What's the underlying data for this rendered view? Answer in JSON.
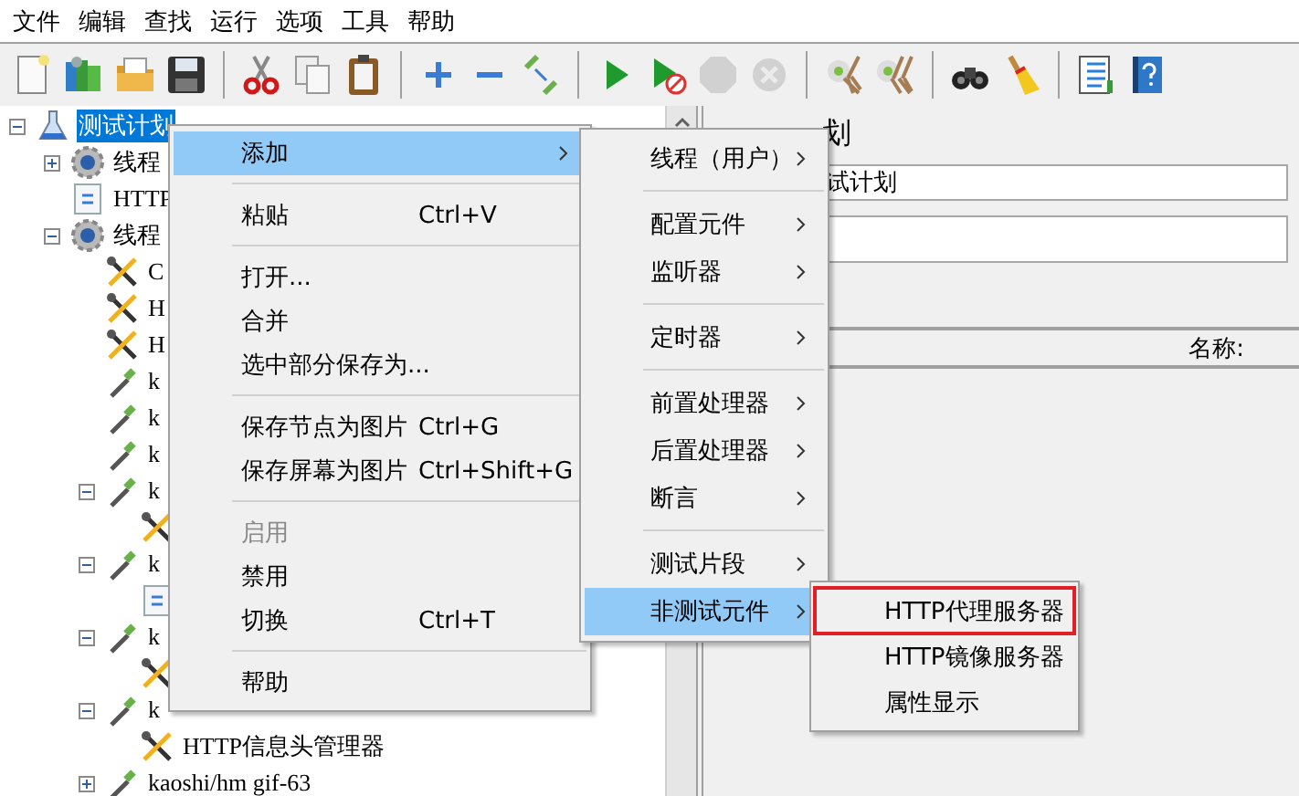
{
  "menu_bar": [
    "文件",
    "编辑",
    "查找",
    "运行",
    "选项",
    "工具",
    "帮助"
  ],
  "toolbar": [
    {
      "kind": "new",
      "disabled": false
    },
    {
      "kind": "templates",
      "disabled": false
    },
    {
      "kind": "open",
      "disabled": false
    },
    {
      "kind": "save",
      "disabled": false
    },
    {
      "kind": "separator"
    },
    {
      "kind": "cut",
      "disabled": false
    },
    {
      "kind": "copy",
      "disabled": false
    },
    {
      "kind": "paste",
      "disabled": false
    },
    {
      "kind": "separator"
    },
    {
      "kind": "expand",
      "disabled": false
    },
    {
      "kind": "collapse",
      "disabled": false
    },
    {
      "kind": "toggle",
      "disabled": false
    },
    {
      "kind": "separator"
    },
    {
      "kind": "start",
      "disabled": false
    },
    {
      "kind": "start_no_pause",
      "disabled": false
    },
    {
      "kind": "stop",
      "disabled": true
    },
    {
      "kind": "shutdown",
      "disabled": true
    },
    {
      "kind": "separator"
    },
    {
      "kind": "clear",
      "disabled": false
    },
    {
      "kind": "clear_all",
      "disabled": false
    },
    {
      "kind": "separator"
    },
    {
      "kind": "search",
      "disabled": false
    },
    {
      "kind": "reset_search",
      "disabled": false
    },
    {
      "kind": "separator"
    },
    {
      "kind": "functions",
      "disabled": false
    },
    {
      "kind": "help",
      "disabled": false
    }
  ],
  "tree": {
    "nodes": [
      {
        "kind": "plan",
        "label": "测试计划",
        "selected": true,
        "expanded": true,
        "children": [
          {
            "kind": "gear",
            "label": "线程",
            "selected": false,
            "expanded": false
          },
          {
            "kind": "doc",
            "label": "HTTP",
            "selected": false
          },
          {
            "kind": "gear",
            "label": "线程",
            "selected": false,
            "expanded": true,
            "children": [
              {
                "kind": "wrench",
                "label": "C",
                "selected": false
              },
              {
                "kind": "wrench",
                "label": "H",
                "selected": false
              },
              {
                "kind": "wrench",
                "label": "H",
                "selected": false
              },
              {
                "kind": "pipette",
                "label": "k",
                "selected": false
              },
              {
                "kind": "pipette",
                "label": "k",
                "selected": false
              },
              {
                "kind": "pipette",
                "label": "k",
                "selected": false
              },
              {
                "kind": "pipette",
                "label": "k",
                "selected": false,
                "expanded": true,
                "children": [
                  {
                    "kind": "wrench",
                    "selected": false
                  }
                ]
              },
              {
                "kind": "pipette",
                "label": "k",
                "selected": false,
                "expanded": true,
                "children": [
                  {
                    "kind": "doc",
                    "selected": false
                  }
                ]
              },
              {
                "kind": "pipette",
                "label": "k",
                "selected": false,
                "expanded": true,
                "children": [
                  {
                    "kind": "wrench",
                    "selected": false
                  }
                ]
              },
              {
                "kind": "pipette",
                "label": "k",
                "selected": false,
                "expanded": true,
                "children": [
                  {
                    "kind": "wrench",
                    "label": "HTTP信息头管理器",
                    "selected": false
                  }
                ]
              },
              {
                "kind": "pipette",
                "label": "kaoshi/hm gif-63",
                "selected": false,
                "expanded": false
              }
            ]
          }
        ]
      }
    ]
  },
  "test_plan_panel": {
    "title": "划",
    "name_value": "试计划",
    "column_header": "名称:"
  },
  "context_menu": {
    "items": [
      {
        "kind": "item",
        "label": "添加",
        "selected": true,
        "disabled": false,
        "has_submenu": true
      },
      {
        "kind": "separator"
      },
      {
        "kind": "item",
        "label": "粘贴",
        "shortcut": "Ctrl+V",
        "selected": false,
        "disabled": false,
        "has_submenu": false
      },
      {
        "kind": "separator"
      },
      {
        "kind": "item",
        "label": "打开...",
        "selected": false,
        "disabled": false,
        "has_submenu": false
      },
      {
        "kind": "item",
        "label": "合并",
        "selected": false,
        "disabled": false,
        "has_submenu": false
      },
      {
        "kind": "item",
        "label": "选中部分保存为...",
        "selected": false,
        "disabled": false,
        "has_submenu": false
      },
      {
        "kind": "separator"
      },
      {
        "kind": "item",
        "label": "保存节点为图片",
        "shortcut": "Ctrl+G",
        "selected": false,
        "disabled": false,
        "has_submenu": false
      },
      {
        "kind": "item",
        "label": "保存屏幕为图片",
        "shortcut": "Ctrl+Shift+G",
        "selected": false,
        "disabled": false,
        "has_submenu": false
      },
      {
        "kind": "separator"
      },
      {
        "kind": "item",
        "label": "启用",
        "selected": false,
        "disabled": true,
        "has_submenu": false
      },
      {
        "kind": "item",
        "label": "禁用",
        "selected": false,
        "disabled": false,
        "has_submenu": false
      },
      {
        "kind": "item",
        "label": "切换",
        "shortcut": "Ctrl+T",
        "selected": false,
        "disabled": false,
        "has_submenu": false
      },
      {
        "kind": "separator"
      },
      {
        "kind": "item",
        "label": "帮助",
        "selected": false,
        "disabled": false,
        "has_submenu": false
      }
    ]
  },
  "add_submenu": {
    "items": [
      {
        "kind": "item",
        "label": "线程（用户）",
        "selected": false,
        "disabled": false,
        "has_submenu": true
      },
      {
        "kind": "separator"
      },
      {
        "kind": "item",
        "label": "配置元件",
        "selected": false,
        "disabled": false,
        "has_submenu": true
      },
      {
        "kind": "item",
        "label": "监听器",
        "selected": false,
        "disabled": false,
        "has_submenu": true
      },
      {
        "kind": "separator"
      },
      {
        "kind": "item",
        "label": "定时器",
        "selected": false,
        "disabled": false,
        "has_submenu": true
      },
      {
        "kind": "separator"
      },
      {
        "kind": "item",
        "label": "前置处理器",
        "selected": false,
        "disabled": false,
        "has_submenu": true
      },
      {
        "kind": "item",
        "label": "后置处理器",
        "selected": false,
        "disabled": false,
        "has_submenu": true
      },
      {
        "kind": "item",
        "label": "断言",
        "selected": false,
        "disabled": false,
        "has_submenu": true
      },
      {
        "kind": "separator"
      },
      {
        "kind": "item",
        "label": "测试片段",
        "selected": false,
        "disabled": false,
        "has_submenu": true
      },
      {
        "kind": "item",
        "label": "非测试元件",
        "selected": true,
        "disabled": false,
        "has_submenu": true
      }
    ]
  },
  "non_test_submenu": {
    "items": [
      {
        "kind": "item",
        "label": "HTTP代理服务器",
        "selected": false,
        "disabled": false,
        "has_submenu": false,
        "outlined": true
      },
      {
        "kind": "item",
        "label": "HTTP镜像服务器",
        "selected": false,
        "disabled": false,
        "has_submenu": false,
        "outlined": false
      },
      {
        "kind": "item",
        "label": "属性显示",
        "selected": false,
        "disabled": false,
        "has_submenu": false,
        "outlined": false
      }
    ]
  }
}
